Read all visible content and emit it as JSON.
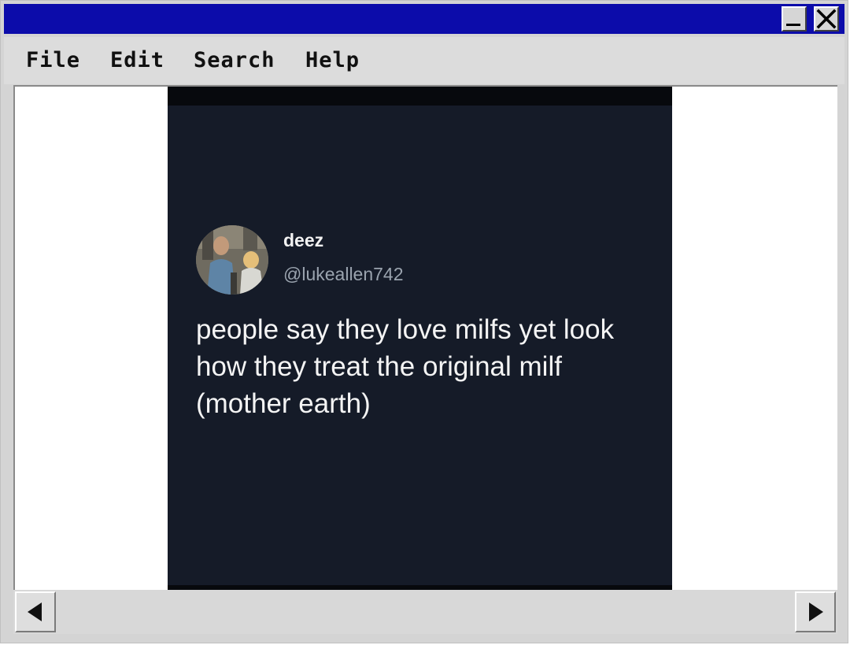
{
  "menu": {
    "items": [
      "File",
      "Edit",
      "Search",
      "Help"
    ]
  },
  "titlebar": {
    "minimize_icon": "minimize-icon",
    "close_icon": "close-icon",
    "color": "#0c0caa"
  },
  "tweet": {
    "display_name": "deez",
    "handle": "@lukeallen742",
    "text_lines": [
      "people say they love milfs yet look",
      "how they treat the original milf",
      "(mother earth)"
    ],
    "background": "#151b28"
  },
  "scrollbar": {
    "left_icon": "arrow-left-icon",
    "right_icon": "arrow-right-icon"
  }
}
